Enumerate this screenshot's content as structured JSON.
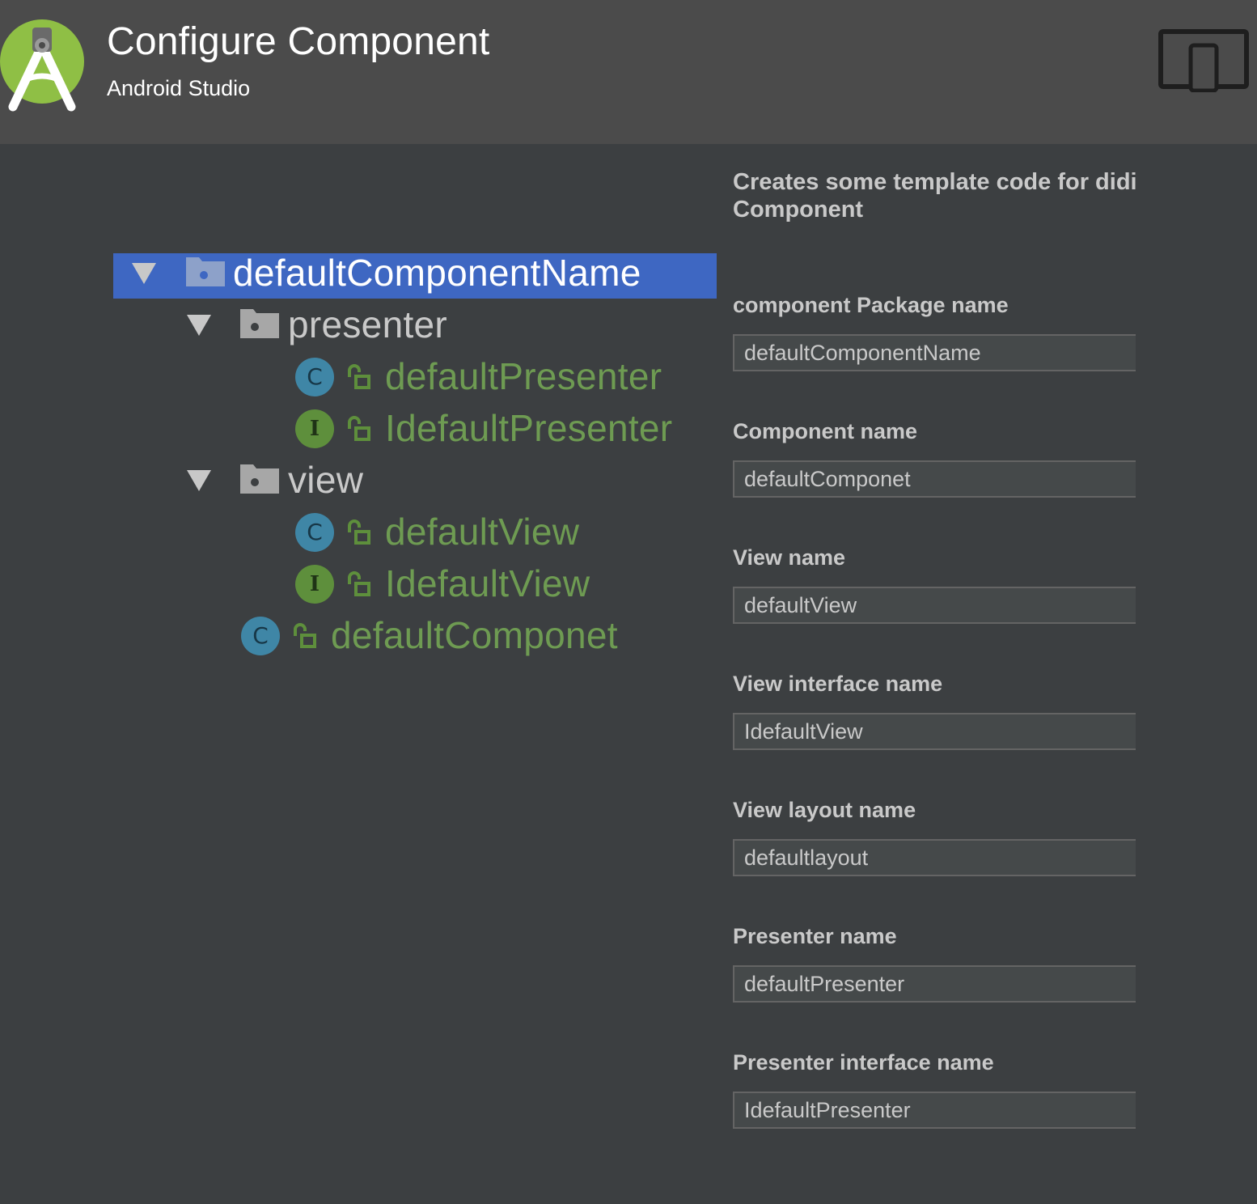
{
  "header": {
    "title": "Configure Component",
    "subtitle": "Android Studio",
    "logo_icon": "android-studio-logo",
    "device_icon": "tablet-phone-icon"
  },
  "tree": {
    "root": "defaultComponentName",
    "presenter_folder": "presenter",
    "presenter_class": "defaultPresenter",
    "presenter_interface": "IdefaultPresenter",
    "view_folder": "view",
    "view_class": "defaultView",
    "view_interface": "IdefaultView",
    "component_class": "defaultComponet",
    "class_badge": "C",
    "interface_badge": "I"
  },
  "form": {
    "description": "Creates some template code for didi Component",
    "fields": [
      {
        "label": "component Package name",
        "value": "defaultComponentName"
      },
      {
        "label": "Component name",
        "value": "defaultComponet"
      },
      {
        "label": "View name",
        "value": "defaultView"
      },
      {
        "label": "View interface name",
        "value": "IdefaultView"
      },
      {
        "label": "View layout name",
        "value": "defaultlayout"
      },
      {
        "label": "Presenter name",
        "value": "defaultPresenter"
      },
      {
        "label": "Presenter interface name",
        "value": "IdefaultPresenter"
      }
    ]
  },
  "colors": {
    "header_bg": "#4b4b4b",
    "body_bg": "#3c3f41",
    "selection": "#3e67c2",
    "class_badge": "#3f86a6",
    "interface_badge": "#5e8f3c",
    "class_text": "#6e9b52"
  }
}
